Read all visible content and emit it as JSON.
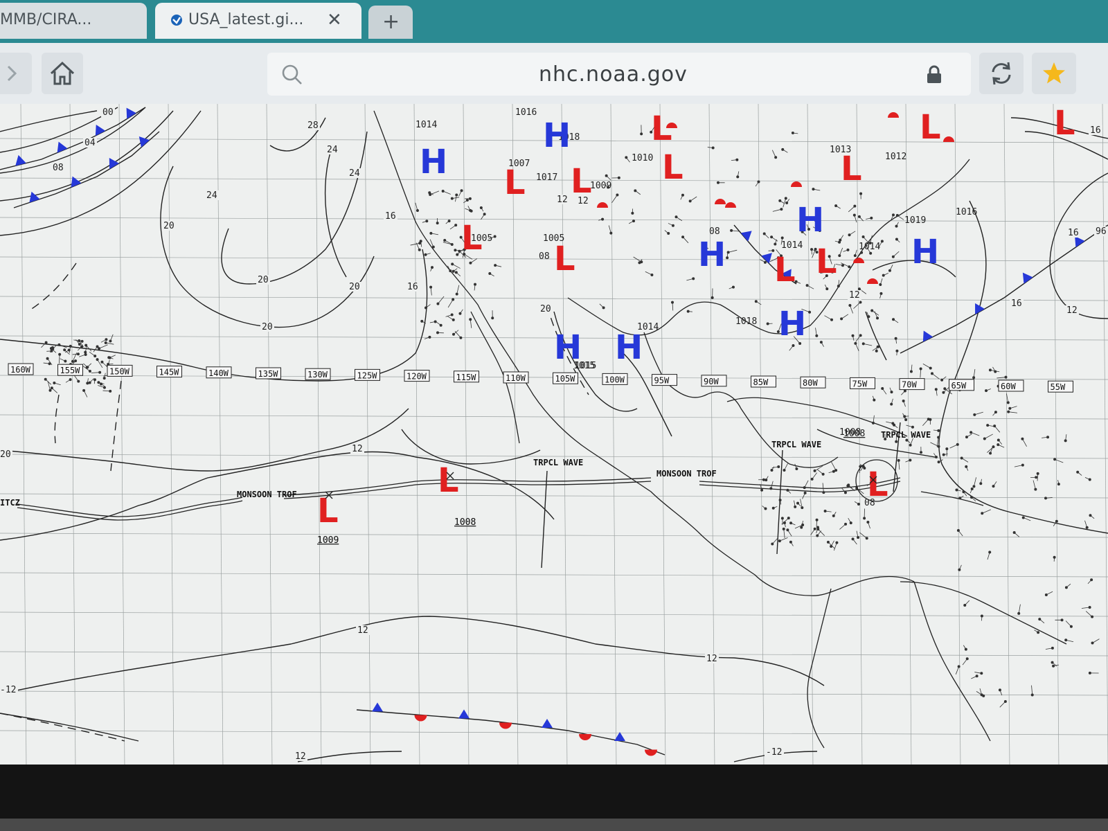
{
  "browser": {
    "tabs": [
      {
        "label": "MMB/CIRA..."
      },
      {
        "label": "USA_latest.gi...",
        "close": "✕"
      }
    ],
    "new_tab_label": "+",
    "url": "nhc.noaa.gov",
    "icons": [
      "forward-icon",
      "home-icon",
      "search-icon",
      "lock-icon",
      "reload-icon",
      "star-icon"
    ],
    "star_color": "#f5b81c"
  },
  "map": {
    "longitudes": [
      "160W",
      "155W",
      "150W",
      "145W",
      "140W",
      "135W",
      "130W",
      "125W",
      "120W",
      "115W",
      "110W",
      "105W",
      "100W",
      "95W",
      "90W",
      "85W",
      "80W",
      "75W",
      "70W",
      "65W",
      "60W",
      "55W"
    ],
    "high_symbol": "H",
    "low_symbol": "L",
    "colors": {
      "high": "#2638d8",
      "low": "#e02020",
      "isobar": "#222222"
    },
    "pressure_values": [
      "1016",
      "1014",
      "1007",
      "1017",
      "1018",
      "1010",
      "1009",
      "1013",
      "1012",
      "1019",
      "1015",
      "1014",
      "1005",
      "1014",
      "1018",
      "1008",
      "1009",
      "1008",
      "1015",
      "1016",
      "1014",
      "08",
      "12",
      "08",
      "1005"
    ],
    "isobar_labels": [
      "00",
      "04",
      "08",
      "28",
      "24",
      "24",
      "20",
      "20",
      "24",
      "20",
      "20",
      "16",
      "16",
      "20",
      "12",
      "12",
      "12",
      "12",
      "12",
      "16",
      "16",
      "96",
      "12",
      "20",
      "-12",
      "-12",
      "12",
      "16"
    ],
    "annotations": {
      "monsoon_1": "MONSOON TROF",
      "monsoon_2": "MONSOON TROF",
      "wave_1": "TRPCL WAVE",
      "wave_2": "TRPCL WAVE",
      "wave_3": "TRPCL WAVE",
      "itcz": "ITCZ",
      "low_1009": "1009",
      "low_1008": "1008",
      "low_1008b": "1008",
      "low_08": "08"
    }
  }
}
